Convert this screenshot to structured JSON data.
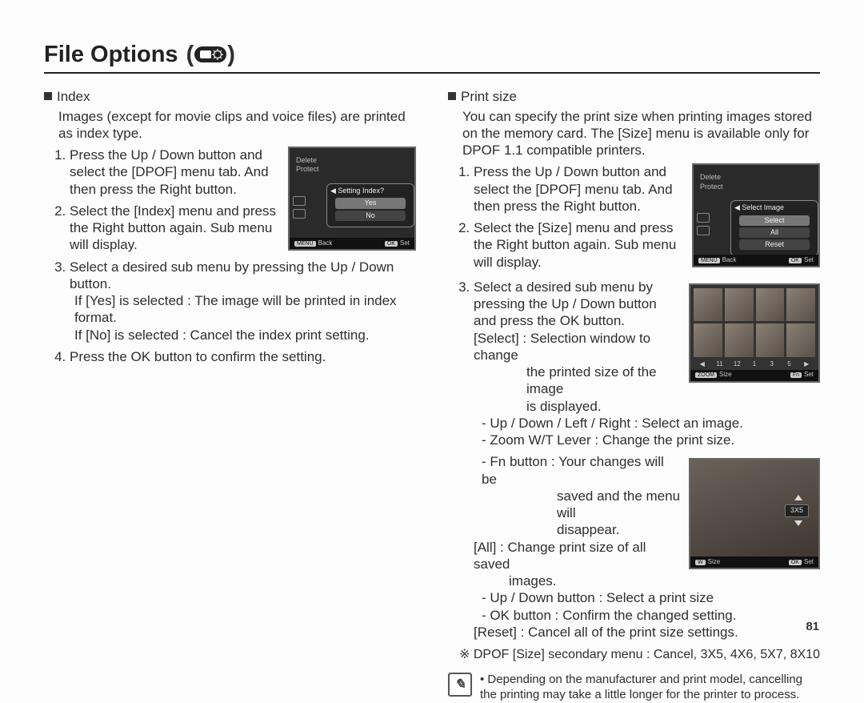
{
  "title": "File Options",
  "title_paren_open": "(",
  "title_paren_close": ")",
  "page_number": "81",
  "left": {
    "heading": "Index",
    "intro": "Images (except for movie clips and voice files) are printed as index type.",
    "steps": {
      "s1": "Press the Up / Down button and select the [DPOF] menu tab. And then press the Right button.",
      "s2": "Select the [Index] menu and press the Right button again. Sub menu will display.",
      "s3": "Select a desired sub menu by pressing the Up / Down button.",
      "s3a": "If [Yes] is selected : The image will be printed in index format.",
      "s3b": "If [No] is selected   : Cancel the index print setting.",
      "s4": "Press the OK button to confirm the setting."
    },
    "screen": {
      "menu1": "Delete",
      "menu2": "Protect",
      "popup_title": "Setting Index?",
      "opt_yes": "Yes",
      "opt_no": "No",
      "back_key": "MENU",
      "back_label": "Back",
      "set_key": "OK",
      "set_label": "Set"
    }
  },
  "right": {
    "heading": "Print size",
    "intro": "You can specify the print size when printing images stored on the memory card. The [Size] menu is available only for DPOF 1.1 compatible printers.",
    "steps": {
      "s1": "Press the Up / Down button and select the [DPOF] menu tab. And then press the Right button.",
      "s2": "Select the [Size] menu and press the Right button again. Sub menu will display.",
      "s3": "Select a desired sub menu by pressing the Up / Down button and press the OK button.",
      "select_label": "[Select] : Selection window to change",
      "select_line2": "the printed size of the image",
      "select_line3": "is displayed.",
      "dash1": "- Up / Down / Left / Right : Select an image.",
      "dash2": "- Zoom W/T Lever : Change the print size.",
      "dash3": "- Fn button : Your changes will be",
      "dash3b": "saved and the menu will",
      "dash3c": "disappear.",
      "all_label": "[All] : Change print size of all saved",
      "all_line2": "images.",
      "dash4": "- Up / Down button : Select a print size",
      "dash5": "- OK button : Confirm the changed setting.",
      "reset_label": "[Reset] : Cancel all of the print size settings."
    },
    "screenA": {
      "menu1": "Delete",
      "menu2": "Protect",
      "popup_title": "Select Image",
      "opt1": "Select",
      "opt2": "All",
      "opt3": "Reset",
      "back_key": "MENU",
      "back_label": "Back",
      "set_key": "OK",
      "set_label": "Set"
    },
    "thumbs": {
      "n1": "11",
      "n2": "12",
      "n3": "1",
      "n4": "3",
      "n5": "5",
      "key1": "ZOOM",
      "label1": "Size",
      "key2": "Fn",
      "label2": "Set"
    },
    "preview": {
      "badge": "3X5",
      "key1": "W",
      "label1": "Size",
      "key2": "OK",
      "label2": "Set"
    },
    "secondary_menu": "DPOF [Size] secondary menu : Cancel, 3X5, 4X6, 5X7, 8X10",
    "secondary_mark": "※",
    "note": "Depending on the manufacturer and print model, cancelling the printing may take a little longer for the printer to process."
  }
}
